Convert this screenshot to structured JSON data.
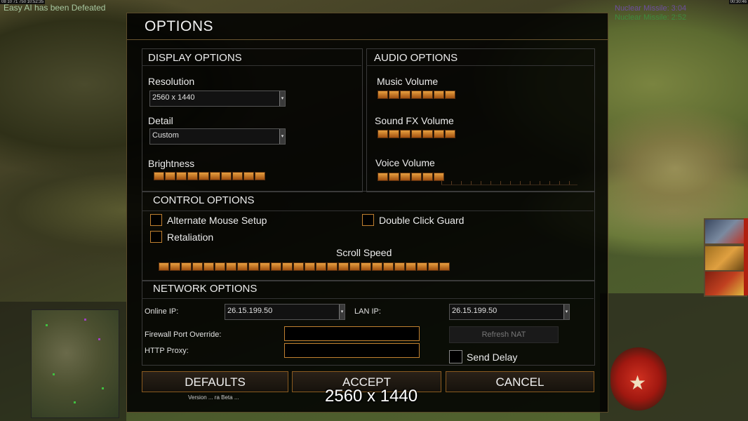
{
  "hud": {
    "top_left_stats": "08 10 71 750 10:52:35",
    "top_right_clock": "00:30:46",
    "defeat_message": "Easy AI has been Defeated",
    "missiles": [
      "Nuclear Missile: 3:04",
      "Nuclear Missile: 2:52"
    ]
  },
  "dialog": {
    "title": "OPTIONS",
    "display": {
      "heading": "DISPLAY OPTIONS",
      "resolution_label": "Resolution",
      "resolution_value": "2560 x 1440",
      "detail_label": "Detail",
      "detail_value": "Custom",
      "brightness_label": "Brightness",
      "brightness_level": 10
    },
    "audio": {
      "heading": "AUDIO OPTIONS",
      "music_label": "Music Volume",
      "music_level": 7,
      "sfx_label": "Sound FX Volume",
      "sfx_level": 7,
      "voice_label": "Voice Volume",
      "voice_level": 6
    },
    "control": {
      "heading": "CONTROL OPTIONS",
      "alt_mouse_label": "Alternate Mouse Setup",
      "alt_mouse_checked": false,
      "double_click_label": "Double Click Guard",
      "double_click_checked": false,
      "retaliation_label": "Retaliation",
      "retaliation_checked": false,
      "scroll_label": "Scroll Speed",
      "scroll_level": 26
    },
    "network": {
      "heading": "NETWORK OPTIONS",
      "online_ip_label": "Online IP:",
      "online_ip_value": "26.15.199.50",
      "lan_ip_label": "LAN IP:",
      "lan_ip_value": "26.15.199.50",
      "firewall_label": "Firewall Port Override:",
      "firewall_value": "",
      "proxy_label": "HTTP Proxy:",
      "proxy_value": "",
      "refresh_nat_label": "Refresh NAT",
      "send_delay_label": "Send Delay",
      "send_delay_checked": false
    },
    "buttons": {
      "defaults": "DEFAULTS",
      "accept": "ACCEPT",
      "cancel": "CANCEL"
    },
    "version_text": "Version ... ra Beta ...",
    "tooltip_text": "2560 x 1440"
  },
  "colors": {
    "accent": "#c08030",
    "slider_on": "#e8a040",
    "panel_border": "#3a3a3a"
  }
}
